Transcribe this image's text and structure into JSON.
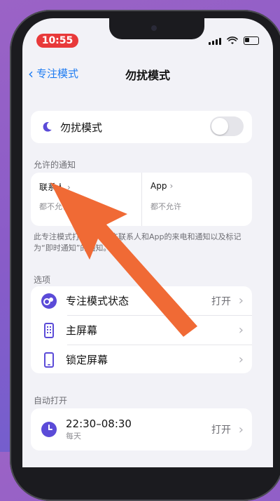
{
  "status": {
    "time": "10:55"
  },
  "nav": {
    "back_label": "专注模式",
    "title": "勿扰模式"
  },
  "dnd": {
    "label": "勿扰模式",
    "enabled": false
  },
  "allowed": {
    "section": "允许的通知",
    "contacts": {
      "title": "联系人",
      "subtitle": "都不允许"
    },
    "apps": {
      "title": "App",
      "subtitle": "都不允许"
    },
    "note": "此专注模式打开时，允许联系人和App的来电和通知以及标记为“即时通知”的通知。"
  },
  "options": {
    "section": "选项",
    "items": [
      {
        "label": "专注模式状态",
        "value": "打开"
      },
      {
        "label": "主屏幕",
        "value": ""
      },
      {
        "label": "锁定屏幕",
        "value": ""
      }
    ]
  },
  "auto": {
    "section": "自动打开",
    "schedule": {
      "time": "22:30–08:30",
      "subtitle": "每天",
      "value": "打开"
    }
  },
  "colors": {
    "accent": "#1f7cf2",
    "arrow": "#f06a35",
    "purple": "#5b4bd8",
    "time_pill": "#e8393a"
  }
}
